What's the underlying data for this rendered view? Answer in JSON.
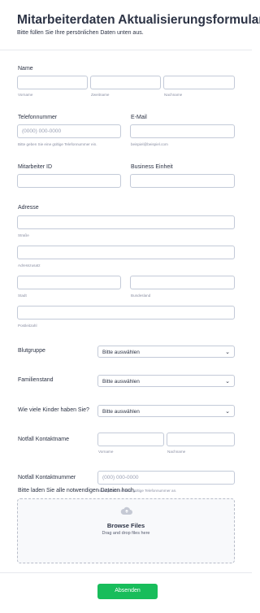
{
  "header": {
    "title": "Mitarbeiterdaten Aktualisierungsformular",
    "subtitle": "Bitte füllen Sie Ihre persönlichen Daten unten aus."
  },
  "name": {
    "label": "Name",
    "first": "Vorname",
    "middle": "Zweitname",
    "last": "Nachname"
  },
  "phone": {
    "label": "Telefonnummer",
    "placeholder": "(0000) 000-0000",
    "hint": "Bitte geben Sie eine gültige Telefonnummer ein."
  },
  "email": {
    "label": "E-Mail",
    "hint": "beispiel@beispiel.com"
  },
  "employee_id": {
    "label": "Mitarbeiter ID"
  },
  "business_unit": {
    "label": "Business Einheit"
  },
  "address": {
    "label": "Adresse",
    "street": "Straße",
    "street2": "Adresszusatz",
    "city": "Stadt",
    "state": "Bundesland",
    "zip": "Postleitzahl"
  },
  "blood_type": {
    "label": "Blutgruppe",
    "value": "Bitte auswählen"
  },
  "marital": {
    "label": "Familienstand",
    "value": "Bitte auswählen"
  },
  "children": {
    "label": "Wie viele Kinder haben Sie?",
    "value": "Bitte auswählen"
  },
  "emergency_contact": {
    "label": "Notfall Kontaktname",
    "first": "Vorname",
    "last": "Nachname"
  },
  "emergency_phone": {
    "label": "Notfall Kontaktnummer",
    "placeholder": "(000) 000-0000",
    "hint": "Bitte geben Sie eine gültige Telefonnummer an."
  },
  "upload": {
    "label": "Bitte laden Sie alle notwendigen Dateien hoch.",
    "title": "Browse Files",
    "subtitle": "Drag and drop files here",
    "icon": "cloud-upload-icon"
  },
  "submit": {
    "label": "Absenden",
    "color": "#18bd5b"
  }
}
